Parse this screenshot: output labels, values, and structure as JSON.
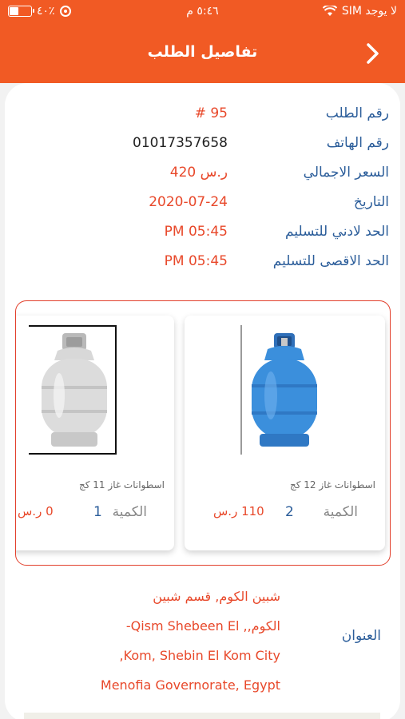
{
  "status_bar": {
    "carrier": "لا يوجد SIM",
    "time": "٥:٤٦ م",
    "battery_text": "٤٠٪",
    "battery_level": 0.4
  },
  "header": {
    "title": "تفاصيل الطلب",
    "back_icon": "chevron-right-icon"
  },
  "order": {
    "fields": [
      {
        "label": "رقم الطلب",
        "value": "# 95"
      },
      {
        "label": "رقم الهاتف",
        "value": "01017357658"
      },
      {
        "label": "السعر الاجمالي",
        "value": "420 ر.س"
      },
      {
        "label": "التاريخ",
        "value": "2020-07-24"
      },
      {
        "label": "الحد لادني للتسليم",
        "value": "PM 05:45"
      },
      {
        "label": "الحد الاقصى للتسليم",
        "value": "PM 05:45"
      }
    ]
  },
  "products": [
    {
      "name": "اسطوانات غاز 12 كج",
      "qty_label": "الكمية",
      "qty": "2",
      "price": "110 ر.س",
      "image_color": "#3b8fdc"
    },
    {
      "name": "اسطوانات غاز 11 كج",
      "qty_label": "الكمية",
      "qty": "1",
      "price": "0 ر.س",
      "image_color": "#d8d8d8"
    }
  ],
  "address": {
    "label": "العنوان",
    "lines": [
      "شبين الكوم, قسم شبين",
      "الكوم,, Qism Shebeen El-",
      "Kom, Shebin El Kom City,",
      "Menofia Governorate, Egypt"
    ]
  },
  "colors": {
    "accent": "#f15a24",
    "label_blue": "#2b5d9a",
    "value_orange": "#e8482a"
  }
}
